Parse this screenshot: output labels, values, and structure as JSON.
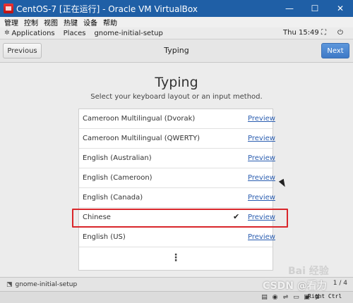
{
  "window": {
    "title": "CentOS-7 [正在运行] - Oracle VM VirtualBox",
    "controls": {
      "minimize": "—",
      "maximize": "☐",
      "close": "✕"
    }
  },
  "vbox_menu": [
    "管理",
    "控制",
    "视图",
    "热键",
    "设备",
    "帮助"
  ],
  "gnome_panel": {
    "applications": "Applications",
    "places": "Places",
    "active_app": "gnome-initial-setup",
    "clock": "Thu 15:49"
  },
  "header": {
    "previous_label": "Previous",
    "title": "Typing",
    "next_label": "Next"
  },
  "page": {
    "title": "Typing",
    "subtitle": "Select your keyboard layout or an input method."
  },
  "layouts": [
    {
      "name": "Cameroon Multilingual (Dvorak)",
      "preview": "Preview",
      "selected": false
    },
    {
      "name": "Cameroon Multilingual (QWERTY)",
      "preview": "Preview",
      "selected": false
    },
    {
      "name": "English (Australian)",
      "preview": "Preview",
      "selected": false
    },
    {
      "name": "English (Cameroon)",
      "preview": "Preview",
      "selected": false
    },
    {
      "name": "English (Canada)",
      "preview": "Preview",
      "selected": false
    },
    {
      "name": "Chinese",
      "preview": "Preview",
      "selected": true,
      "check": "✔"
    },
    {
      "name": "English (US)",
      "preview": "Preview",
      "selected": false
    }
  ],
  "more_label": "⋮",
  "taskbar": {
    "task": "gnome-initial-setup",
    "page_indicator": "1 / 4"
  },
  "statusbar": {
    "host_key": "Right Ctrl"
  },
  "watermark": "CSDN @看力",
  "watermark_top": "Bai 经验",
  "colors": {
    "accent": "#3e79c6",
    "highlight": "#d9262b",
    "title_bar": "#1f5fa6"
  }
}
